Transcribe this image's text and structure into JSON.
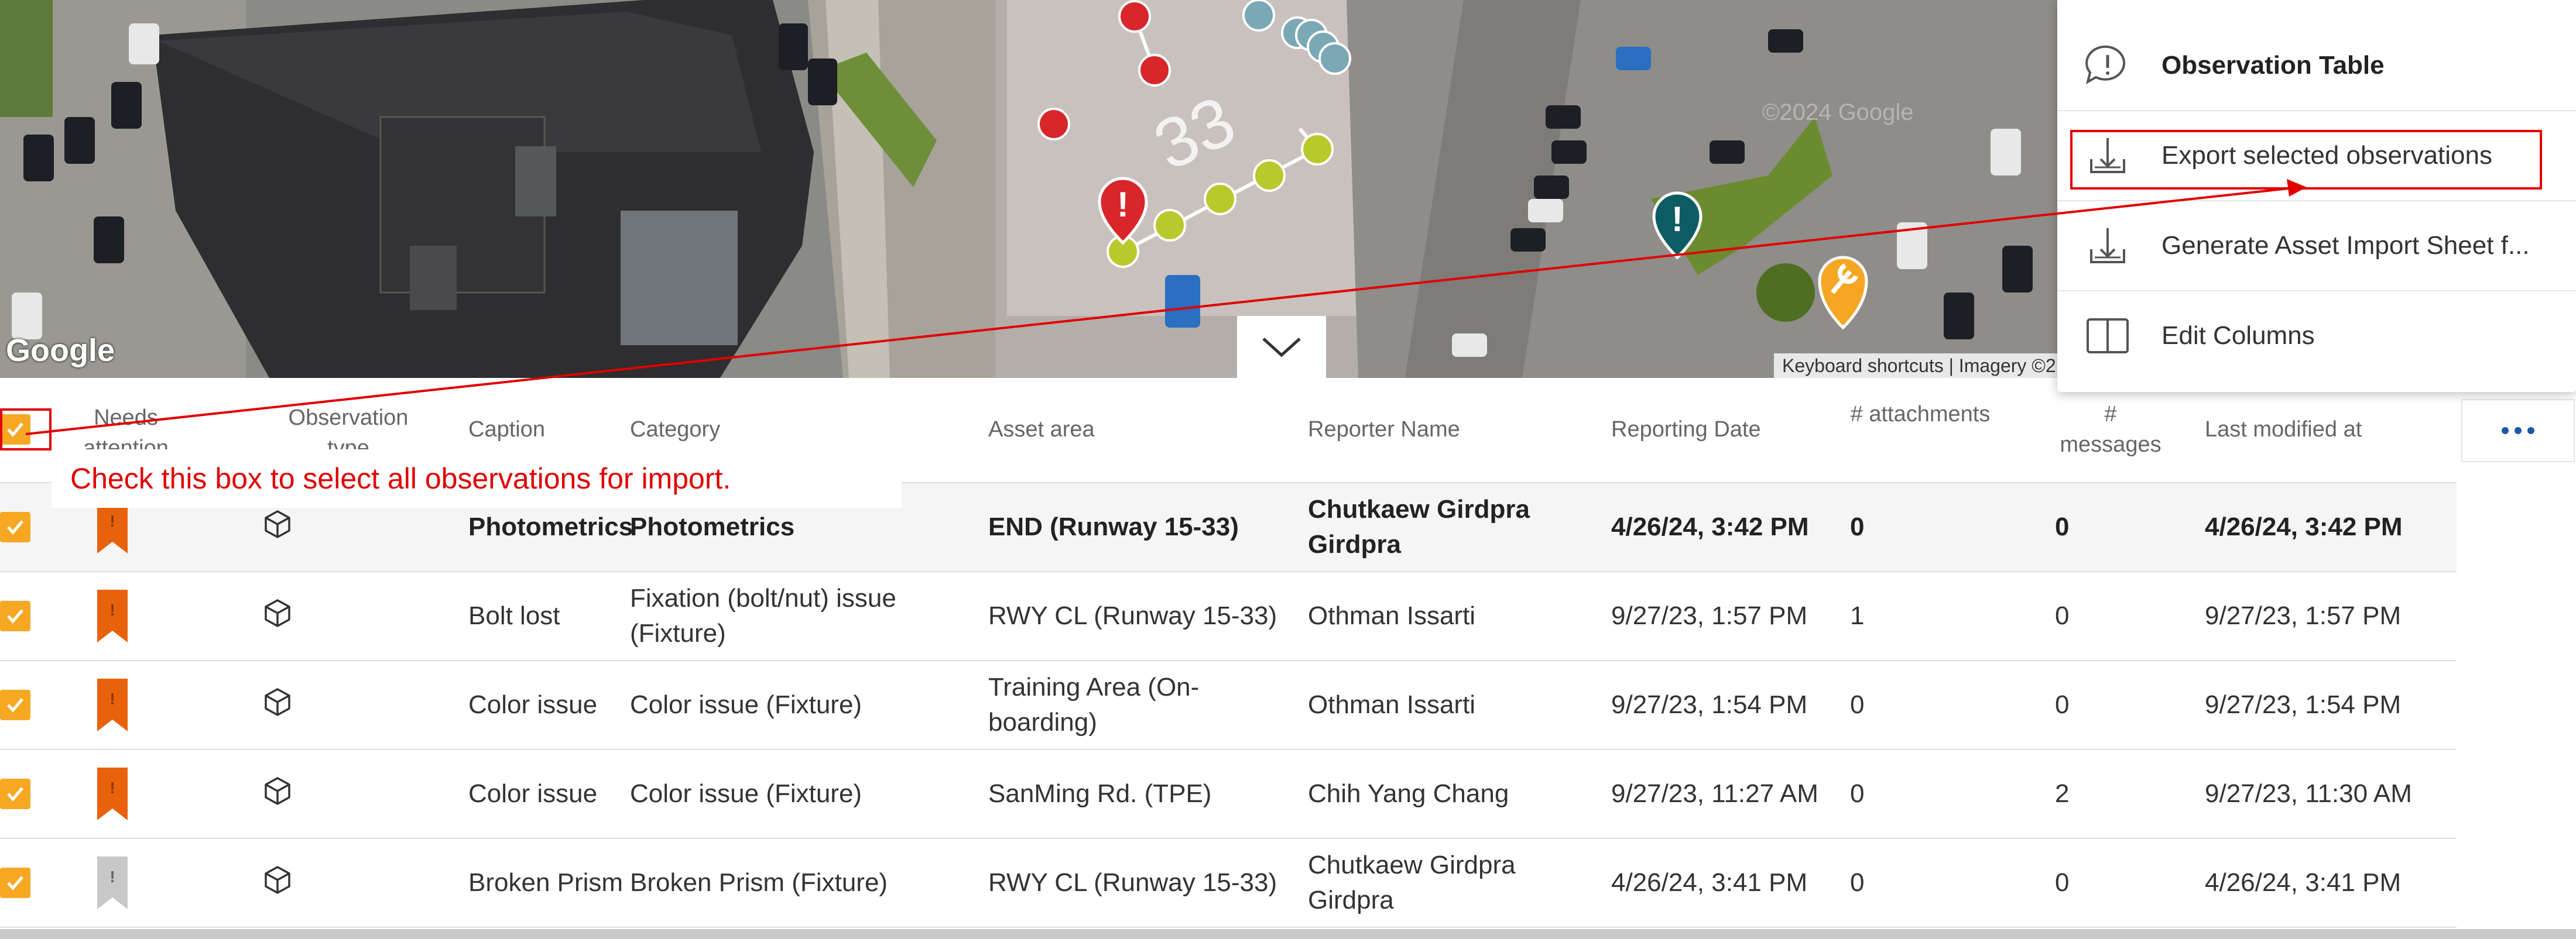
{
  "map": {
    "attribution": "Keyboard shortcuts  |  Imagery ©2",
    "logo": "Google",
    "watermark": "©2024 Google",
    "label_33": "33"
  },
  "annotation": {
    "hint": "Check this box to select all observations for import."
  },
  "menu": {
    "items": [
      {
        "label": "Observation Table",
        "icon": "alert-bubble-icon"
      },
      {
        "label": "Export selected observations",
        "icon": "download-tray-icon"
      },
      {
        "label": "Generate Asset Import Sheet f...",
        "icon": "download-tray-icon"
      },
      {
        "label": "Edit Columns",
        "icon": "columns-icon"
      }
    ]
  },
  "table": {
    "headers": {
      "needs_attention": "Needs attention",
      "observation_type": "Observation type",
      "caption": "Caption",
      "category": "Category",
      "asset_area": "Asset area",
      "reporter": "Reporter Name",
      "reporting_date": "Reporting Date",
      "attachments": "# attachments",
      "messages": "# messages",
      "last_modified": "Last modified at"
    },
    "rows": [
      {
        "caption": "Photometrics",
        "category": "Photometrics",
        "area": "END  (Runway 15-33)",
        "reporter": "Chutkaew Girdpra Girdpra",
        "date": "4/26/24, 3:42 PM",
        "attachments": "0",
        "messages": "0",
        "modified": "4/26/24, 3:42 PM",
        "flag_color": "#e8620c"
      },
      {
        "caption": "Bolt lost",
        "category": "Fixation (bolt/nut) issue (Fixture)",
        "area": "RWY CL  (Runway 15-33)",
        "reporter": "Othman Issarti",
        "date": "9/27/23, 1:57 PM",
        "attachments": "1",
        "messages": "0",
        "modified": "9/27/23, 1:57 PM",
        "flag_color": "#e8620c"
      },
      {
        "caption": "Color issue",
        "category": "Color issue (Fixture)",
        "area": "Training Area  (On-boarding)",
        "reporter": "Othman Issarti",
        "date": "9/27/23, 1:54 PM",
        "attachments": "0",
        "messages": "0",
        "modified": "9/27/23, 1:54 PM",
        "flag_color": "#e8620c"
      },
      {
        "caption": "Color issue",
        "category": "Color issue (Fixture)",
        "area": "SanMing Rd.  (TPE)",
        "reporter": "Chih Yang Chang",
        "date": "9/27/23, 11:27 AM",
        "attachments": "0",
        "messages": "2",
        "modified": "9/27/23, 11:30 AM",
        "flag_color": "#e8620c"
      },
      {
        "caption": "Broken Prism",
        "category": "Broken Prism (Fixture)",
        "area": "RWY CL  (Runway 15-33)",
        "reporter": "Chutkaew Girdpra Girdpra",
        "date": "4/26/24, 3:41 PM",
        "attachments": "0",
        "messages": "0",
        "modified": "4/26/24, 3:41 PM",
        "flag_color": "#c8c8c8"
      }
    ]
  }
}
